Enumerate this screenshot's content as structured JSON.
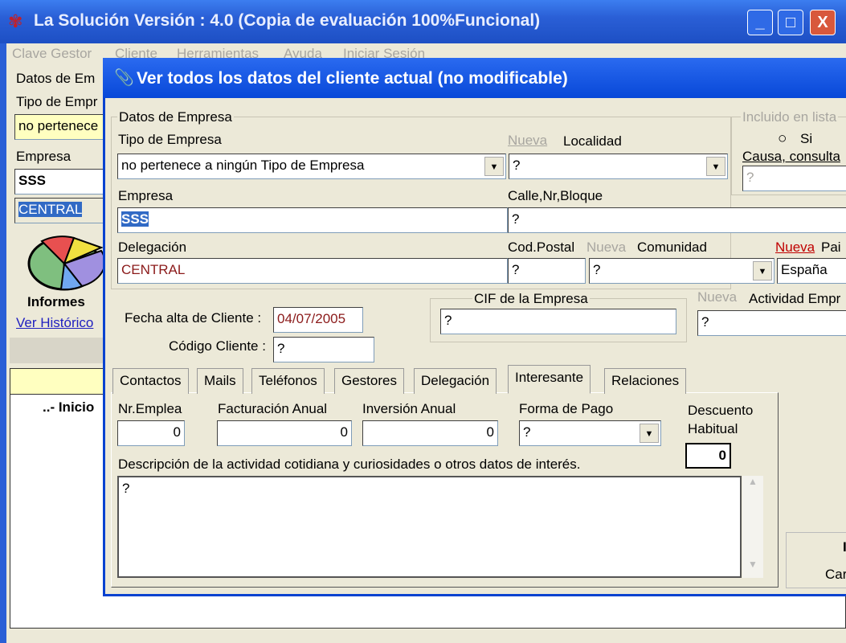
{
  "window": {
    "title": "La Solución  Versión :  4.0 (Copia de evaluación 100%Funcional)",
    "min": "_",
    "max": "□",
    "close": "X"
  },
  "menu": [
    "Clave Gestor",
    "Cliente",
    "Herramientas",
    "Ayuda",
    "Iniciar Sesión"
  ],
  "left": {
    "group": "Datos de Em",
    "tipo_label": "Tipo de Empr",
    "tipo_value": "no pertenece",
    "empresa_label": "Empresa",
    "empresa_value": "SSS",
    "delegacion_value": "CENTRAL",
    "informes": "Informes",
    "historico": "Ver Histórico",
    "list_item": "..- Inicio"
  },
  "dialog": {
    "title": "Ver todos los datos del cliente actual (no modificable)",
    "group": "Datos de Empresa",
    "tipo_label": "Tipo de Empresa",
    "tipo_value": "no pertenece a ningún Tipo de Empresa",
    "nueva": "Nueva",
    "localidad_label": "Localidad",
    "localidad_value": "?",
    "empresa_label": "Empresa",
    "empresa_value": "SSS",
    "calle_label": "Calle,Nr,Bloque",
    "calle_value": "?",
    "delegacion_label": "Delegación",
    "delegacion_value": "CENTRAL",
    "cp_label": "Cod.Postal",
    "cp_value": "?",
    "comunidad_label": "Comunidad",
    "comunidad_value": "?",
    "pais_label": "Pai",
    "pais_value": "España",
    "lista_group": "Incluido en lista",
    "si": "Si",
    "causa_label": "Causa, consulta",
    "causa_value": "?",
    "fecha_label": "Fecha alta de Cliente :",
    "fecha_value": "04/07/2005",
    "codigo_label": "Código Cliente :",
    "codigo_value": "?",
    "cif_group": "CIF de la Empresa",
    "cif_value": "?",
    "actividad_label": "Actividad Empr",
    "actividad_value": "?",
    "tabs": [
      "Contactos",
      "Mails",
      "Teléfonos",
      "Gestores",
      "Delegación",
      "Interesante",
      "Relaciones"
    ],
    "active_tab": "Interesante",
    "nr_label": "Nr.Emplea",
    "nr_value": "0",
    "fact_label": "Facturación Anual",
    "fact_value": "0",
    "inv_label": "Inversión Anual",
    "inv_value": "0",
    "pago_label": "Forma de Pago",
    "pago_value": "?",
    "desc_label1": "Descuento",
    "desc_label2": "Habitual",
    "desc_value": "0",
    "descripcion_label": "Descripción de la actividad cotidiana y curiosidades o otros datos de interés.",
    "descripcion_value": "?",
    "btn_top": "I",
    "btn_bottom": "Car"
  },
  "colors": {
    "title_blue": "#0848d8",
    "highlight": "#316ac5",
    "red_text": "#8b1a1a",
    "link_red": "#c00000",
    "yellow": "#ffffc0"
  }
}
